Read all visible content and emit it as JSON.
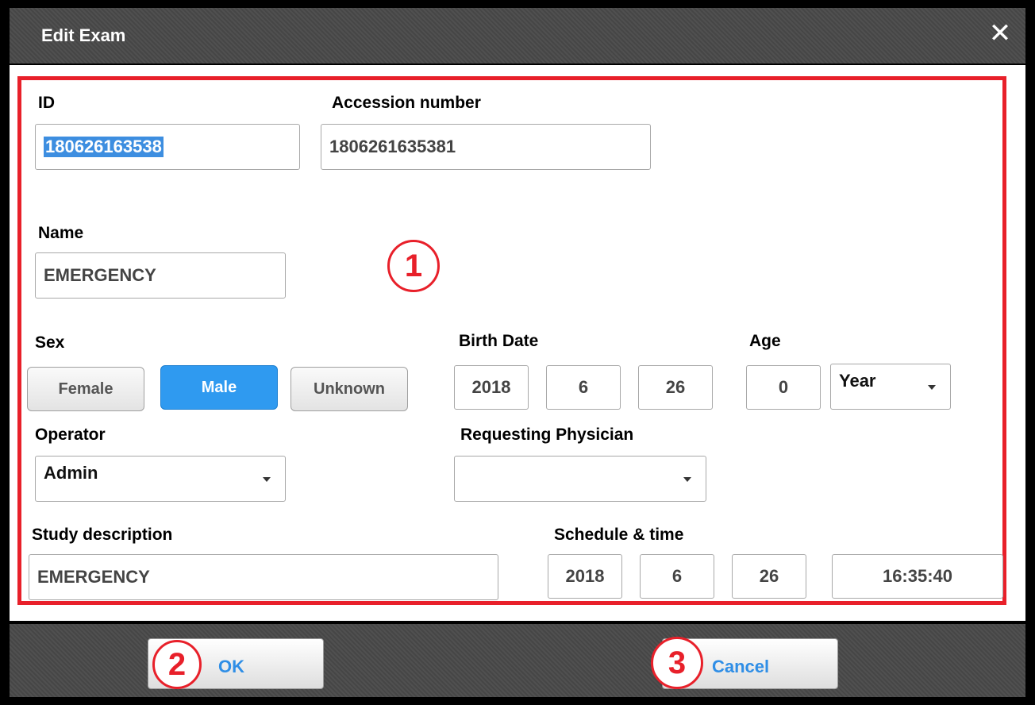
{
  "dialog": {
    "title": "Edit Exam",
    "close_glyph": "✕"
  },
  "labels": {
    "id": "ID",
    "accession": "Accession number",
    "name": "Name",
    "sex": "Sex",
    "birth_date": "Birth Date",
    "age": "Age",
    "operator": "Operator",
    "requesting_physician": "Requesting Physician",
    "study_description": "Study description",
    "schedule_time": "Schedule & time"
  },
  "fields": {
    "id": "180626163538",
    "accession": "1806261635381",
    "name": "EMERGENCY",
    "birth_year": "2018",
    "birth_month": "6",
    "birth_day": "26",
    "age_value": "0",
    "age_unit": "Year",
    "operator": "Admin",
    "requesting_physician": "",
    "study_description": "EMERGENCY",
    "schedule_year": "2018",
    "schedule_month": "6",
    "schedule_day": "26",
    "schedule_time": "16:35:40"
  },
  "sex_buttons": {
    "female": "Female",
    "male": "Male",
    "unknown": "Unknown",
    "selected": "male"
  },
  "footer": {
    "ok": "OK",
    "cancel": "Cancel"
  },
  "callouts": {
    "one": "1",
    "two": "2",
    "three": "3"
  },
  "colors": {
    "highlight": "#e8202a",
    "accent": "#2f9af0",
    "link": "#2f8ee6"
  }
}
